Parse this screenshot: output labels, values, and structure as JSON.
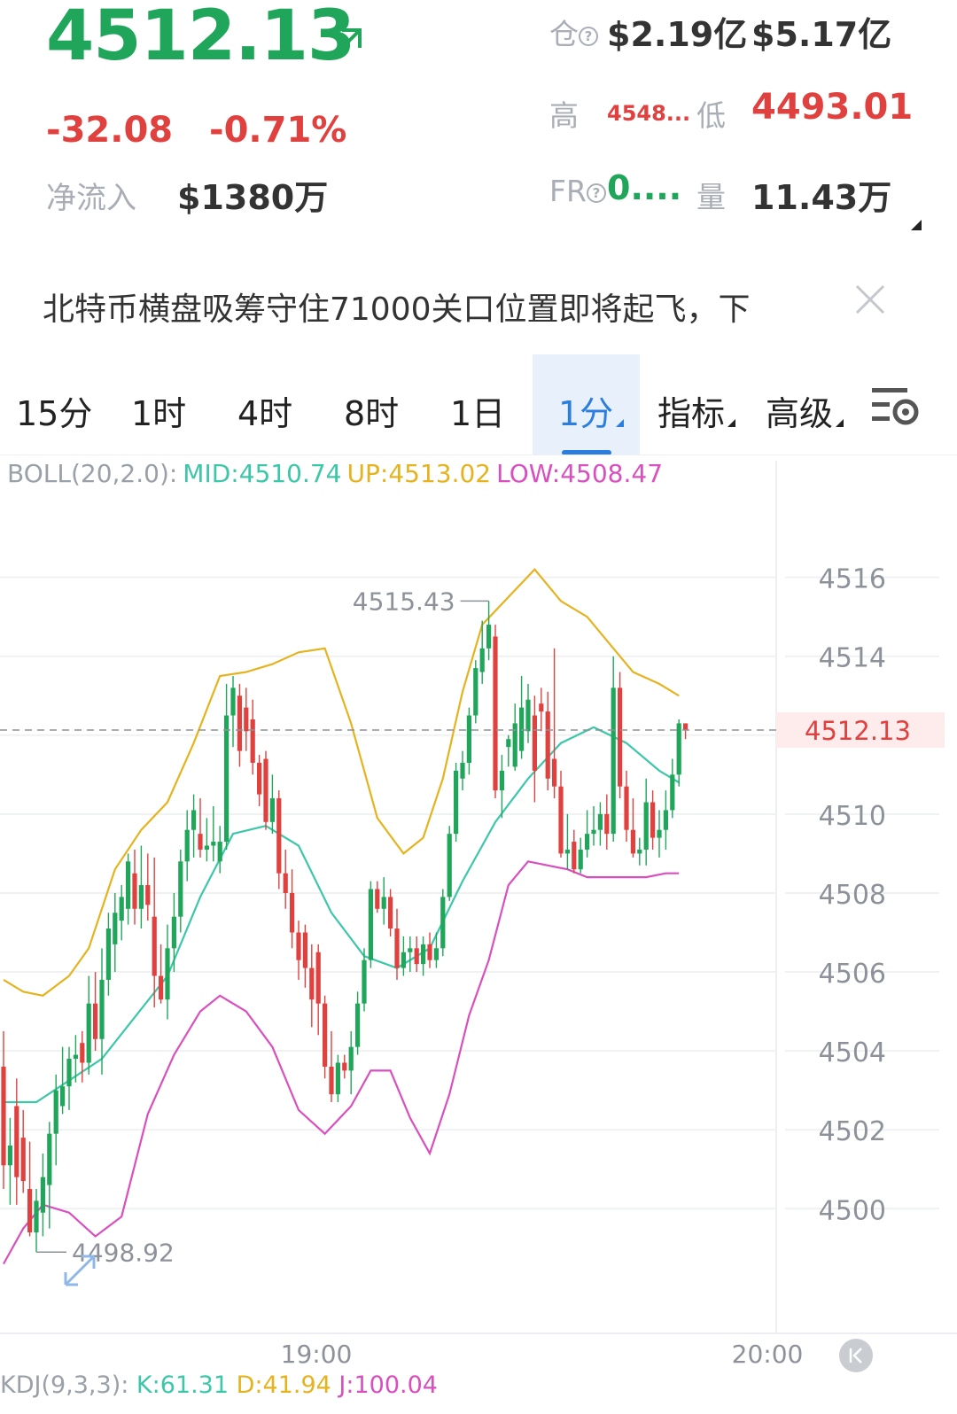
{
  "header": {
    "price": "4512.13",
    "change": "-32.08",
    "change_pct": "-0.71%",
    "net_inflow_label": "净流入",
    "net_inflow_value": "$1380万",
    "open_interest_label": "仓",
    "open_interest_value": "$2.19亿",
    "turnover_value": "$5.17亿",
    "high_label": "高",
    "high_value": "4548...",
    "low_label": "低",
    "low_value": "4493.01",
    "funding_rate_label": "FR",
    "funding_rate_value": "0....",
    "volume_label": "量",
    "volume_value": "11.43万"
  },
  "news": {
    "text": "北特币横盘吸筹守住71000关口位置即将起飞，下"
  },
  "tabs": [
    {
      "label": "15分",
      "active": false,
      "dropdown": false
    },
    {
      "label": "1时",
      "active": false,
      "dropdown": false
    },
    {
      "label": "4时",
      "active": false,
      "dropdown": false
    },
    {
      "label": "8时",
      "active": false,
      "dropdown": false
    },
    {
      "label": "1日",
      "active": false,
      "dropdown": false
    },
    {
      "label": "1分",
      "active": true,
      "dropdown": true
    },
    {
      "label": "指标",
      "active": false,
      "dropdown": true
    },
    {
      "label": "高级",
      "active": false,
      "dropdown": true
    }
  ],
  "boll": {
    "prefix": "BOLL(20,2.0):",
    "mid": "MID:4510.74",
    "up": "UP:4513.02",
    "low": "LOW:4508.47"
  },
  "colors": {
    "up": "#1fa65a",
    "down": "#e0413f",
    "mid_line": "#3cc7a8",
    "upper_band": "#e6b31e",
    "lower_band": "#d94fbf",
    "active_tab": "#2b7de0"
  },
  "chart_data": {
    "type": "candlestick",
    "yticks": [
      4500,
      4502,
      4504,
      4506,
      4508,
      4510,
      4512,
      4514,
      4516
    ],
    "ylim": [
      4498.3,
      4516.8
    ],
    "current_price": "4512.13",
    "max_label": "4515.43",
    "min_label": "4498.92",
    "x_ticks": [
      "19:00",
      "20:00"
    ],
    "grid": true,
    "candles": [
      {
        "o": 4503.6,
        "h": 4504.5,
        "l": 4500.5,
        "c": 4501.1
      },
      {
        "o": 4501.1,
        "h": 4502.3,
        "l": 4500.1,
        "c": 4501.6
      },
      {
        "o": 4502.6,
        "h": 4503.3,
        "l": 4500.1,
        "c": 4500.8
      },
      {
        "o": 4501.8,
        "h": 4502.5,
        "l": 4500.4,
        "c": 4500.7
      },
      {
        "o": 4500.5,
        "h": 4501.7,
        "l": 4499.3,
        "c": 4499.4
      },
      {
        "o": 4499.4,
        "h": 4500.5,
        "l": 4498.9,
        "c": 4500.2
      },
      {
        "o": 4499.9,
        "h": 4501.4,
        "l": 4499.3,
        "c": 4500.8
      },
      {
        "o": 4500.6,
        "h": 4502.2,
        "l": 4499.5,
        "c": 4501.9
      },
      {
        "o": 4501.9,
        "h": 4503.4,
        "l": 4501.1,
        "c": 4503.0
      },
      {
        "o": 4502.6,
        "h": 4504.1,
        "l": 4502.4,
        "c": 4503.1
      },
      {
        "o": 4503.1,
        "h": 4504.1,
        "l": 4502.5,
        "c": 4503.8
      },
      {
        "o": 4503.8,
        "h": 4504.4,
        "l": 4503.2,
        "c": 4503.9
      },
      {
        "o": 4504.2,
        "h": 4504.5,
        "l": 4503.2,
        "c": 4503.7
      },
      {
        "o": 4503.7,
        "h": 4505.9,
        "l": 4503.4,
        "c": 4505.2
      },
      {
        "o": 4505.2,
        "h": 4506.0,
        "l": 4504.0,
        "c": 4504.3
      },
      {
        "o": 4504.3,
        "h": 4506.6,
        "l": 4503.4,
        "c": 4505.8
      },
      {
        "o": 4505.8,
        "h": 4507.5,
        "l": 4505.4,
        "c": 4507.1
      },
      {
        "o": 4506.7,
        "h": 4508.0,
        "l": 4506.0,
        "c": 4507.5
      },
      {
        "o": 4507.3,
        "h": 4508.2,
        "l": 4506.8,
        "c": 4507.9
      },
      {
        "o": 4507.6,
        "h": 4509.0,
        "l": 4507.2,
        "c": 4508.8
      },
      {
        "o": 4508.5,
        "h": 4509.1,
        "l": 4507.2,
        "c": 4507.6
      },
      {
        "o": 4507.6,
        "h": 4509.2,
        "l": 4507.1,
        "c": 4508.2
      },
      {
        "o": 4508.2,
        "h": 4509.0,
        "l": 4507.3,
        "c": 4507.7
      },
      {
        "o": 4507.4,
        "h": 4508.9,
        "l": 4505.1,
        "c": 4505.9
      },
      {
        "o": 4505.9,
        "h": 4506.7,
        "l": 4505.2,
        "c": 4505.3
      },
      {
        "o": 4505.3,
        "h": 4507.2,
        "l": 4504.8,
        "c": 4506.6
      },
      {
        "o": 4506.6,
        "h": 4508.0,
        "l": 4506.0,
        "c": 4507.4
      },
      {
        "o": 4507.4,
        "h": 4509.1,
        "l": 4507.0,
        "c": 4508.8
      },
      {
        "o": 4508.8,
        "h": 4510.1,
        "l": 4508.3,
        "c": 4509.6
      },
      {
        "o": 4509.6,
        "h": 4510.5,
        "l": 4508.9,
        "c": 4510.1
      },
      {
        "o": 4509.5,
        "h": 4510.4,
        "l": 4508.9,
        "c": 4509.1
      },
      {
        "o": 4509.1,
        "h": 4509.9,
        "l": 4508.8,
        "c": 4509.2
      },
      {
        "o": 4509.2,
        "h": 4510.2,
        "l": 4508.8,
        "c": 4509.3
      },
      {
        "o": 4508.8,
        "h": 4509.7,
        "l": 4508.5,
        "c": 4509.3
      },
      {
        "o": 4509.3,
        "h": 4513.3,
        "l": 4509.1,
        "c": 4512.5
      },
      {
        "o": 4512.5,
        "h": 4513.5,
        "l": 4511.7,
        "c": 4513.2
      },
      {
        "o": 4513.0,
        "h": 4513.3,
        "l": 4511.2,
        "c": 4511.6
      },
      {
        "o": 4512.7,
        "h": 4513.2,
        "l": 4511.6,
        "c": 4512.1
      },
      {
        "o": 4512.4,
        "h": 4512.9,
        "l": 4511.0,
        "c": 4511.3
      },
      {
        "o": 4511.3,
        "h": 4511.5,
        "l": 4510.2,
        "c": 4510.5
      },
      {
        "o": 4511.4,
        "h": 4511.6,
        "l": 4509.6,
        "c": 4509.8
      },
      {
        "o": 4509.8,
        "h": 4511.0,
        "l": 4509.5,
        "c": 4510.4
      },
      {
        "o": 4510.4,
        "h": 4510.6,
        "l": 4508.1,
        "c": 4508.5
      },
      {
        "o": 4508.5,
        "h": 4509.1,
        "l": 4507.6,
        "c": 4508.0
      },
      {
        "o": 4508.0,
        "h": 4508.6,
        "l": 4506.6,
        "c": 4507.0
      },
      {
        "o": 4507.0,
        "h": 4507.3,
        "l": 4505.8,
        "c": 4506.3
      },
      {
        "o": 4507.0,
        "h": 4507.2,
        "l": 4505.6,
        "c": 4506.1
      },
      {
        "o": 4506.1,
        "h": 4506.7,
        "l": 4504.6,
        "c": 4505.3
      },
      {
        "o": 4506.5,
        "h": 4506.7,
        "l": 4504.4,
        "c": 4505.2
      },
      {
        "o": 4505.2,
        "h": 4505.4,
        "l": 4503.3,
        "c": 4503.6
      },
      {
        "o": 4503.6,
        "h": 4504.5,
        "l": 4502.7,
        "c": 4502.9
      },
      {
        "o": 4502.9,
        "h": 4503.9,
        "l": 4502.7,
        "c": 4503.7
      },
      {
        "o": 4503.7,
        "h": 4503.9,
        "l": 4503.3,
        "c": 4503.5
      },
      {
        "o": 4503.5,
        "h": 4504.5,
        "l": 4502.9,
        "c": 4504.1
      },
      {
        "o": 4504.1,
        "h": 4505.5,
        "l": 4503.9,
        "c": 4505.2
      },
      {
        "o": 4505.2,
        "h": 4506.6,
        "l": 4505.0,
        "c": 4506.3
      },
      {
        "o": 4506.3,
        "h": 4508.3,
        "l": 4506.1,
        "c": 4508.1
      },
      {
        "o": 4508.1,
        "h": 4508.3,
        "l": 4507.5,
        "c": 4507.6
      },
      {
        "o": 4507.6,
        "h": 4508.4,
        "l": 4507.2,
        "c": 4507.9
      },
      {
        "o": 4507.9,
        "h": 4508.1,
        "l": 4506.9,
        "c": 4507.1
      },
      {
        "o": 4507.1,
        "h": 4507.6,
        "l": 4505.8,
        "c": 4506.1
      },
      {
        "o": 4506.1,
        "h": 4506.9,
        "l": 4505.9,
        "c": 4506.5
      },
      {
        "o": 4506.5,
        "h": 4506.9,
        "l": 4506.0,
        "c": 4506.6
      },
      {
        "o": 4506.6,
        "h": 4506.9,
        "l": 4506.0,
        "c": 4506.2
      },
      {
        "o": 4506.2,
        "h": 4506.9,
        "l": 4505.9,
        "c": 4506.7
      },
      {
        "o": 4506.7,
        "h": 4507.0,
        "l": 4506.1,
        "c": 4506.3
      },
      {
        "o": 4506.3,
        "h": 4507.0,
        "l": 4506.1,
        "c": 4506.6
      },
      {
        "o": 4506.6,
        "h": 4508.1,
        "l": 4506.4,
        "c": 4507.9
      },
      {
        "o": 4507.9,
        "h": 4509.7,
        "l": 4507.8,
        "c": 4509.5
      },
      {
        "o": 4509.5,
        "h": 4511.3,
        "l": 4509.3,
        "c": 4511.1
      },
      {
        "o": 4510.9,
        "h": 4511.6,
        "l": 4510.6,
        "c": 4511.3
      },
      {
        "o": 4511.3,
        "h": 4512.7,
        "l": 4511.0,
        "c": 4512.5
      },
      {
        "o": 4512.5,
        "h": 4513.9,
        "l": 4512.3,
        "c": 4513.7
      },
      {
        "o": 4513.6,
        "h": 4514.9,
        "l": 4513.3,
        "c": 4514.2
      },
      {
        "o": 4514.2,
        "h": 4515.4,
        "l": 4513.9,
        "c": 4514.8
      },
      {
        "o": 4514.5,
        "h": 4514.8,
        "l": 4510.4,
        "c": 4510.6
      },
      {
        "o": 4510.6,
        "h": 4511.5,
        "l": 4509.9,
        "c": 4511.1
      },
      {
        "o": 4511.7,
        "h": 4512.0,
        "l": 4511.2,
        "c": 4511.9
      },
      {
        "o": 4511.2,
        "h": 4512.8,
        "l": 4511.1,
        "c": 4512.3
      },
      {
        "o": 4511.6,
        "h": 4513.5,
        "l": 4511.4,
        "c": 4512.7
      },
      {
        "o": 4512.1,
        "h": 4513.3,
        "l": 4511.8,
        "c": 4512.9
      },
      {
        "o": 4512.5,
        "h": 4513.0,
        "l": 4510.3,
        "c": 4511.1
      },
      {
        "o": 4512.8,
        "h": 4513.2,
        "l": 4512.1,
        "c": 4512.6
      },
      {
        "o": 4512.6,
        "h": 4513.1,
        "l": 4510.6,
        "c": 4510.9
      },
      {
        "o": 4511.4,
        "h": 4514.2,
        "l": 4510.4,
        "c": 4510.7
      },
      {
        "o": 4510.7,
        "h": 4511.1,
        "l": 4508.9,
        "c": 4509.0
      },
      {
        "o": 4509.0,
        "h": 4510.0,
        "l": 4508.6,
        "c": 4509.1
      },
      {
        "o": 4509.3,
        "h": 4509.6,
        "l": 4508.5,
        "c": 4508.6
      },
      {
        "o": 4508.6,
        "h": 4509.4,
        "l": 4508.5,
        "c": 4509.1
      },
      {
        "o": 4509.1,
        "h": 4510.1,
        "l": 4508.9,
        "c": 4509.5
      },
      {
        "o": 4509.5,
        "h": 4510.2,
        "l": 4509.2,
        "c": 4509.6
      },
      {
        "o": 4509.6,
        "h": 4510.3,
        "l": 4509.2,
        "c": 4510.0
      },
      {
        "o": 4510.0,
        "h": 4510.5,
        "l": 4509.1,
        "c": 4509.5
      },
      {
        "o": 4509.5,
        "h": 4514.0,
        "l": 4509.3,
        "c": 4513.2
      },
      {
        "o": 4513.2,
        "h": 4513.6,
        "l": 4510.4,
        "c": 4510.7
      },
      {
        "o": 4510.7,
        "h": 4511.1,
        "l": 4509.3,
        "c": 4509.6
      },
      {
        "o": 4509.6,
        "h": 4510.4,
        "l": 4508.9,
        "c": 4509.0
      },
      {
        "o": 4509.0,
        "h": 4509.4,
        "l": 4508.7,
        "c": 4509.1
      },
      {
        "o": 4509.1,
        "h": 4510.9,
        "l": 4508.7,
        "c": 4510.3
      },
      {
        "o": 4510.3,
        "h": 4510.6,
        "l": 4509.1,
        "c": 4509.4
      },
      {
        "o": 4509.4,
        "h": 4510.1,
        "l": 4508.9,
        "c": 4509.6
      },
      {
        "o": 4509.6,
        "h": 4510.6,
        "l": 4509.1,
        "c": 4510.1
      },
      {
        "o": 4510.1,
        "h": 4511.4,
        "l": 4509.9,
        "c": 4511.0
      },
      {
        "o": 4511.0,
        "h": 4512.4,
        "l": 4510.7,
        "c": 4512.3
      },
      {
        "o": 4512.3,
        "h": 4512.3,
        "l": 4511.9,
        "c": 4512.13
      }
    ],
    "mid": [
      [
        0,
        4502.7
      ],
      [
        5,
        4502.7
      ],
      [
        15,
        4503.8
      ],
      [
        25,
        4505.9
      ],
      [
        30,
        4507.9
      ],
      [
        35,
        4509.5
      ],
      [
        40,
        4509.7
      ],
      [
        45,
        4509.2
      ],
      [
        50,
        4507.5
      ],
      [
        55,
        4506.4
      ],
      [
        60,
        4506.1
      ],
      [
        65,
        4506.6
      ],
      [
        70,
        4508.3
      ],
      [
        75,
        4509.8
      ],
      [
        80,
        4510.9
      ],
      [
        85,
        4511.8
      ],
      [
        90,
        4512.2
      ],
      [
        95,
        4511.8
      ],
      [
        100,
        4511.1
      ],
      [
        103,
        4510.8
      ]
    ],
    "upper": [
      [
        0,
        4505.8
      ],
      [
        3,
        4505.5
      ],
      [
        6,
        4505.4
      ],
      [
        10,
        4505.9
      ],
      [
        13,
        4506.6
      ],
      [
        17,
        4508.6
      ],
      [
        21,
        4509.6
      ],
      [
        25,
        4510.3
      ],
      [
        29,
        4511.8
      ],
      [
        33,
        4513.5
      ],
      [
        37,
        4513.6
      ],
      [
        41,
        4513.8
      ],
      [
        45,
        4514.1
      ],
      [
        49,
        4514.2
      ],
      [
        53,
        4512.3
      ],
      [
        57,
        4509.9
      ],
      [
        61,
        4509.0
      ],
      [
        64,
        4509.4
      ],
      [
        67,
        4510.9
      ],
      [
        70,
        4513.1
      ],
      [
        73,
        4514.8
      ],
      [
        77,
        4515.5
      ],
      [
        81,
        4516.2
      ],
      [
        85,
        4515.4
      ],
      [
        89,
        4515.0
      ],
      [
        93,
        4514.2
      ],
      [
        96,
        4513.6
      ],
      [
        100,
        4513.3
      ],
      [
        103,
        4513.0
      ]
    ],
    "lower": [
      [
        0,
        4498.6
      ],
      [
        3,
        4499.5
      ],
      [
        6,
        4500.1
      ],
      [
        10,
        4499.9
      ],
      [
        14,
        4499.3
      ],
      [
        18,
        4499.8
      ],
      [
        22,
        4502.4
      ],
      [
        26,
        4503.9
      ],
      [
        30,
        4505.0
      ],
      [
        33,
        4505.4
      ],
      [
        37,
        4505.0
      ],
      [
        41,
        4504.1
      ],
      [
        45,
        4502.5
      ],
      [
        49,
        4501.9
      ],
      [
        53,
        4502.6
      ],
      [
        56,
        4503.5
      ],
      [
        59,
        4503.5
      ],
      [
        62,
        4502.3
      ],
      [
        65,
        4501.4
      ],
      [
        68,
        4502.9
      ],
      [
        71,
        4504.9
      ],
      [
        74,
        4506.3
      ],
      [
        77,
        4508.2
      ],
      [
        80,
        4508.8
      ],
      [
        83,
        4508.7
      ],
      [
        86,
        4508.6
      ],
      [
        89,
        4508.4
      ],
      [
        92,
        4508.4
      ],
      [
        95,
        4508.4
      ],
      [
        98,
        4508.4
      ],
      [
        101,
        4508.5
      ],
      [
        103,
        4508.5
      ]
    ]
  },
  "kdj": {
    "prefix": "KDJ(9,3,3):",
    "k": "K:61.31",
    "d": "D:41.94",
    "j": "J:100.04"
  }
}
